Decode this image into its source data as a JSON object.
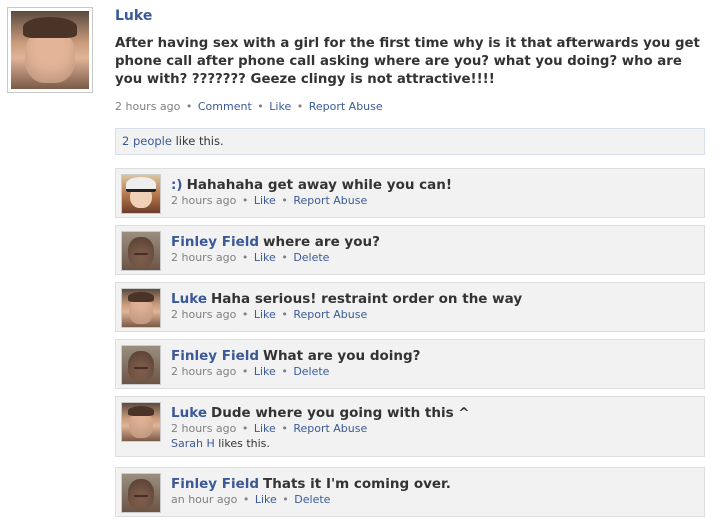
{
  "post": {
    "author": "Luke",
    "body": "After having sex with a girl for the first time why is it that afterwards you get phone call after phone call asking where are you? what you doing? who are you with? ??????? Geeze clingy is not attractive!!!!",
    "time": "2 hours ago",
    "actions": [
      "Comment",
      "Like",
      "Report Abuse"
    ],
    "likes_link": "2 people",
    "likes_suffix": " like this."
  },
  "comments": [
    {
      "author": ":)",
      "text": "Hahahaha get away while you can!",
      "time": "2 hours ago",
      "actions": [
        "Like",
        "Report Abuse"
      ],
      "avatar": "smiley"
    },
    {
      "author": "Finley Field",
      "text": "where are you?",
      "time": "2 hours ago",
      "actions": [
        "Like",
        "Delete"
      ],
      "avatar": "finley"
    },
    {
      "author": "Luke",
      "text": "Haha serious! restraint order on the way",
      "time": "2 hours ago",
      "actions": [
        "Like",
        "Report Abuse"
      ],
      "avatar": "luke"
    },
    {
      "author": "Finley Field",
      "text": "What are you doing?",
      "time": "2 hours ago",
      "actions": [
        "Like",
        "Delete"
      ],
      "avatar": "finley"
    },
    {
      "author": "Luke",
      "text": "Dude where you going with this ^",
      "time": "2 hours ago",
      "actions": [
        "Like",
        "Report Abuse"
      ],
      "avatar": "luke",
      "liked_by": "Sarah H",
      "liked_suffix": " likes this."
    },
    {
      "author": "Finley Field",
      "text": "Thats it I'm coming over.",
      "time": "an hour ago",
      "actions": [
        "Like",
        "Delete"
      ],
      "avatar": "finley"
    }
  ],
  "colors": {
    "link": "#3b5998",
    "box_bg": "#f2f2f2",
    "meta": "#808080"
  }
}
